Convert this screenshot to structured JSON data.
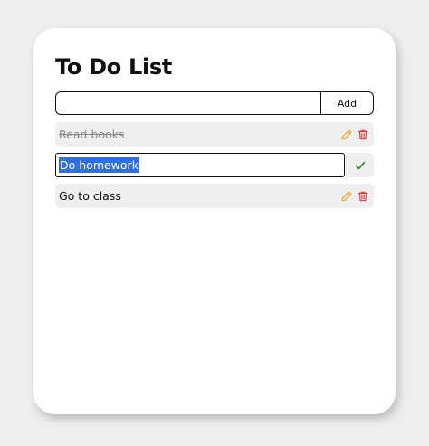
{
  "app": {
    "title": "To Do List"
  },
  "add_form": {
    "input_value": "",
    "placeholder": "",
    "add_label": "Add"
  },
  "todos": [
    {
      "text": "Read books",
      "completed": true,
      "editing": false
    },
    {
      "text": "Do homework",
      "completed": false,
      "editing": true,
      "selected": true
    },
    {
      "text": "Go to class",
      "completed": false,
      "editing": false
    }
  ],
  "icons": {
    "edit": "pencil-icon",
    "delete": "trash-icon",
    "confirm": "check-icon"
  },
  "colors": {
    "background": "#eeeeee",
    "card": "#ffffff",
    "item_background": "#efefef",
    "edit_icon": "#f0a623",
    "delete_icon": "#e23b3b",
    "confirm_icon": "#2e7d32",
    "selection": "#2f6fe0"
  }
}
